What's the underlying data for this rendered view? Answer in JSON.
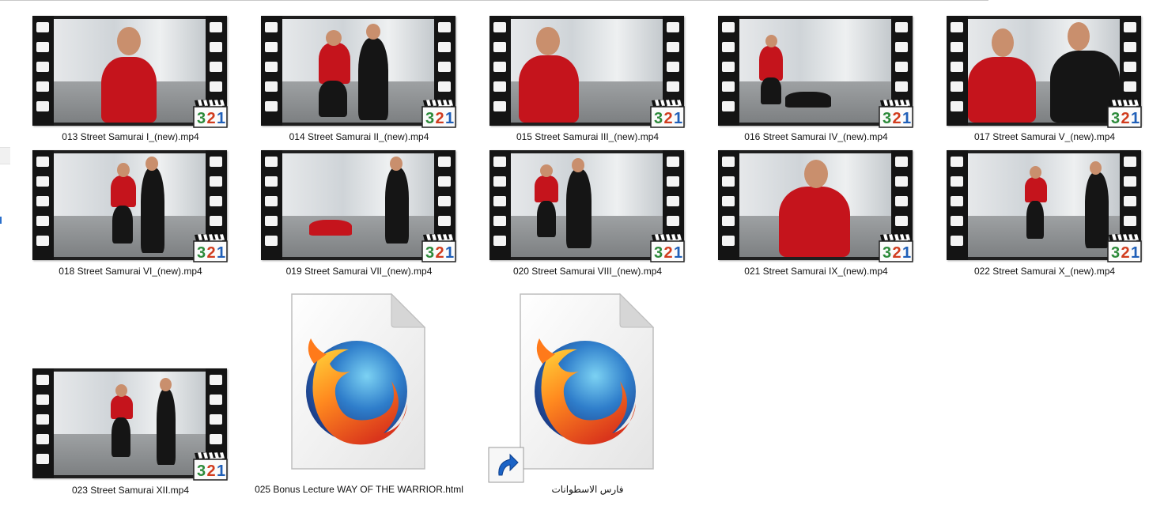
{
  "files": [
    {
      "name": "013 Street Samurai I_(new).mp4",
      "type": "video"
    },
    {
      "name": "014 Street Samurai II_(new).mp4",
      "type": "video"
    },
    {
      "name": "015 Street Samurai III_(new).mp4",
      "type": "video"
    },
    {
      "name": "016 Street Samurai IV_(new).mp4",
      "type": "video"
    },
    {
      "name": "017 Street Samurai V_(new).mp4",
      "type": "video"
    },
    {
      "name": "018 Street Samurai VI_(new).mp4",
      "type": "video"
    },
    {
      "name": "019 Street Samurai VII_(new).mp4",
      "type": "video"
    },
    {
      "name": "020 Street Samurai VIII_(new).mp4",
      "type": "video"
    },
    {
      "name": "021 Street Samurai IX_(new).mp4",
      "type": "video"
    },
    {
      "name": "022 Street Samurai X_(new).mp4",
      "type": "video"
    },
    {
      "name": "023 Street Samurai XII.mp4",
      "type": "video"
    },
    {
      "name": "025 Bonus Lecture WAY OF THE WARRIOR.html",
      "type": "firefox-html"
    },
    {
      "name": "فارس الاسطوانات",
      "type": "firefox-shortcut"
    }
  ],
  "icons": {
    "video_badge": "media-player-321-icon",
    "html_doc": "firefox-document-icon",
    "shortcut": "shortcut-arrow-icon"
  },
  "badge_text": "321",
  "colors": {
    "badge_3": "#2c8a3a",
    "badge_2": "#d13c1e",
    "badge_1": "#1f5fb8",
    "shirt_red": "#c5141c",
    "selection_blue": "#2a6fcb"
  }
}
